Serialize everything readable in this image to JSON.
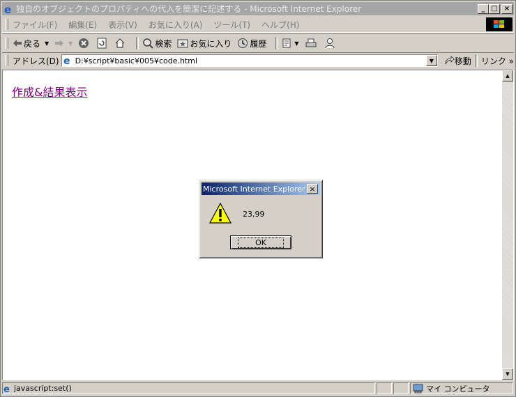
{
  "window": {
    "title": "独自のオブジェクトのプロパティへの代入を簡潔に記述する - Microsoft Internet Explorer",
    "minimize": "_",
    "maximize": "□",
    "close": "×"
  },
  "menu": [
    "ファイル(F)",
    "編集(E)",
    "表示(V)",
    "お気に入り(A)",
    "ツール(T)",
    "ヘルプ(H)"
  ],
  "toolbar": {
    "back": "戻る",
    "search": "検索",
    "favorites": "お気に入り",
    "history": "履歴"
  },
  "address": {
    "label": "アドレス(D)",
    "value": "D:¥script¥basic¥005¥code.html",
    "go": "移動",
    "links": "リンク »"
  },
  "content": {
    "link_text": "作成&結果表示"
  },
  "status": {
    "text": "javascript:set()",
    "zone": "マイ コンピュータ"
  },
  "dialog": {
    "title": "Microsoft Internet Explorer",
    "message": "23,99",
    "ok": "OK",
    "close": "×"
  }
}
